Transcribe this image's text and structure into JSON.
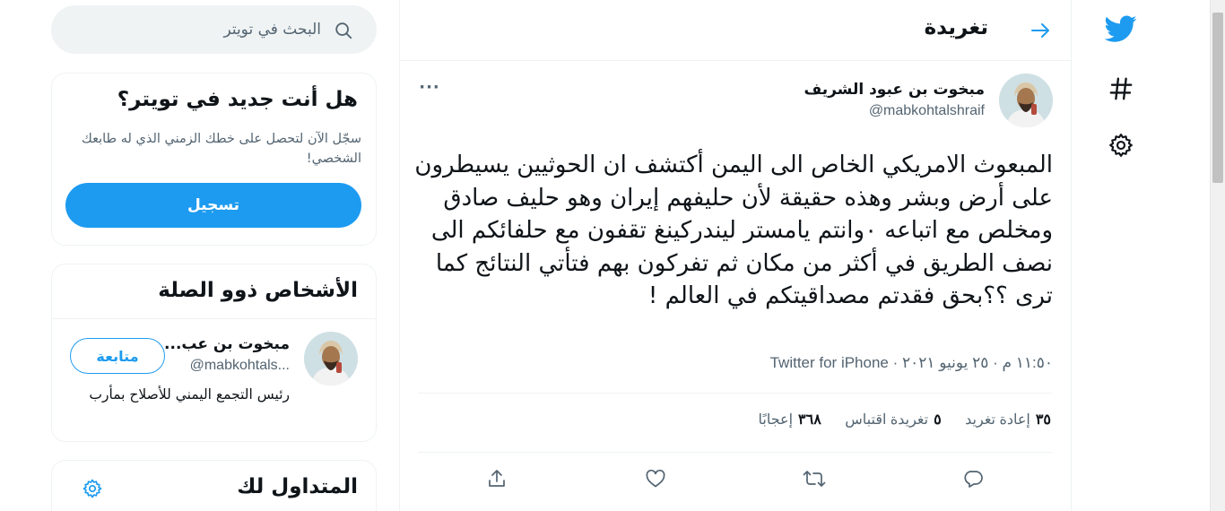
{
  "nav": {
    "logo_icon": "twitter-bird-icon",
    "explore_icon": "hashtag-icon",
    "settings_icon": "gear-icon"
  },
  "header": {
    "title": "تغريدة",
    "back_icon": "arrow-icon"
  },
  "tweet": {
    "author_name": "مبخوت بن عبود الشريف",
    "author_handle": "@mabkohtalshraif",
    "more_label": "···",
    "text": "المبعوث الامريكي الخاص الى اليمن أكتشف ان الحوثيين يسيطرون على أرض وبشر وهذه حقيقة لأن حليفهم إيران وهو حليف صادق ومخلص مع اتباعه ٠وانتم يامستر ليندركينغ تقفون مع حلفائكم الى نصف الطريق في أكثر من مكان ثم تفركون بهم فتأتي النتائج كما ترى ؟؟بحق فقدتم مصداقيتكم في العالم !",
    "meta": "١١:٥٠ م · ٢٥ يونيو ٢٠٢١ · Twitter for iPhone",
    "stats": {
      "retweets_count": "٣٥",
      "retweets_label": "إعادة تغريد",
      "quotes_count": "٥",
      "quotes_label": "تغريدة اقتباس",
      "likes_count": "٣٦٨",
      "likes_label": "إعجابًا"
    },
    "action_icons": [
      "reply-icon",
      "retweet-icon",
      "like-icon",
      "share-icon"
    ]
  },
  "search": {
    "placeholder": "البحث في تويتر"
  },
  "new_to_twitter": {
    "heading": "هل أنت جديد في تويتر؟",
    "subtitle": "سجّل الآن لتحصل على خطك الزمني الذي له طابعك الشخصي!",
    "signup_label": "تسجيل"
  },
  "related": {
    "heading": "الأشخاص ذوو الصلة",
    "person": {
      "name": "مبخوت بن عب...",
      "handle": "@mabkohtals...",
      "bio": "رئيس التجمع اليمني للأصلاح بمأرب",
      "follow_label": "متابعة"
    }
  },
  "trends": {
    "heading": "المتداول لك"
  },
  "colors": {
    "accent": "#1d9bf0",
    "text": "#0f1419",
    "secondary_text": "#536471",
    "border": "#eff3f4"
  }
}
